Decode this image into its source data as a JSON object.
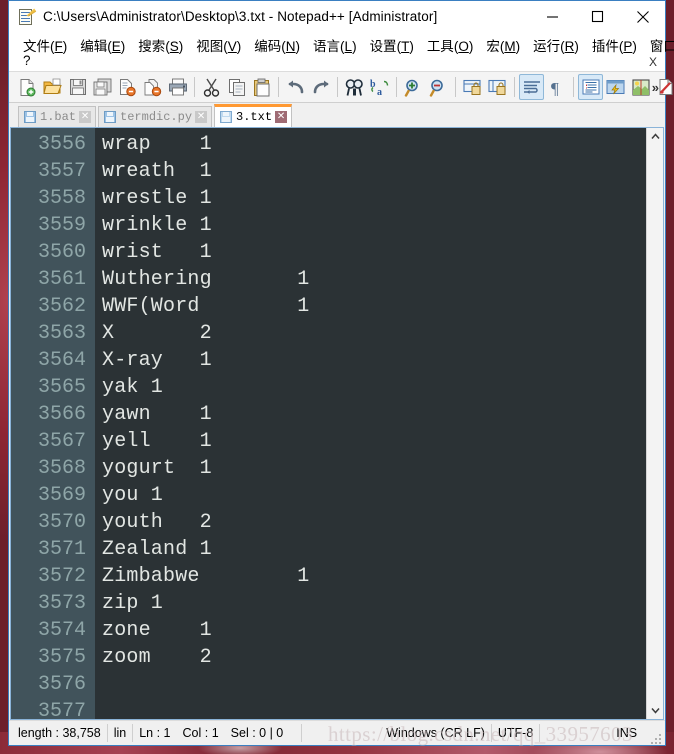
{
  "window": {
    "title": "C:\\Users\\Administrator\\Desktop\\3.txt - Notepad++ [Administrator]",
    "app_icon": "notepad-plus-plus-icon",
    "controls": {
      "minimize": "minimize-icon",
      "maximize": "maximize-icon",
      "close": "close-icon"
    },
    "menubar_close_label": "X"
  },
  "menubar": {
    "items": [
      {
        "text": "文件",
        "accel": "F"
      },
      {
        "text": "编辑",
        "accel": "E"
      },
      {
        "text": "搜索",
        "accel": "S"
      },
      {
        "text": "视图",
        "accel": "V"
      },
      {
        "text": "编码",
        "accel": "N"
      },
      {
        "text": "语言",
        "accel": "L"
      },
      {
        "text": "设置",
        "accel": "T"
      },
      {
        "text": "工具",
        "accel": "O"
      },
      {
        "text": "宏",
        "accel": "M"
      },
      {
        "text": "运行",
        "accel": "R"
      },
      {
        "text": "插件",
        "accel": "P"
      },
      {
        "text": "窗口",
        "accel": "W"
      }
    ],
    "help_label": "?",
    "row2_close_label": "X"
  },
  "toolbar": {
    "overflow_label": "»",
    "buttons": [
      {
        "name": "new-file-icon",
        "tooltip": "新建",
        "active": false
      },
      {
        "name": "open-file-icon",
        "tooltip": "打开",
        "active": false
      },
      {
        "name": "save-icon",
        "tooltip": "保存",
        "active": false
      },
      {
        "name": "save-all-icon",
        "tooltip": "保存所有",
        "active": false
      },
      {
        "name": "close-file-icon",
        "tooltip": "关闭",
        "active": false
      },
      {
        "name": "close-all-icon",
        "tooltip": "关闭所有",
        "active": false
      },
      {
        "name": "print-icon",
        "tooltip": "打印",
        "active": false
      },
      {
        "name": "separator",
        "tooltip": "",
        "active": false
      },
      {
        "name": "cut-icon",
        "tooltip": "剪切",
        "active": false
      },
      {
        "name": "copy-icon",
        "tooltip": "复制",
        "active": false
      },
      {
        "name": "paste-icon",
        "tooltip": "粘贴",
        "active": false
      },
      {
        "name": "separator",
        "tooltip": "",
        "active": false
      },
      {
        "name": "undo-icon",
        "tooltip": "撤销",
        "active": false
      },
      {
        "name": "redo-icon",
        "tooltip": "重做",
        "active": false
      },
      {
        "name": "separator",
        "tooltip": "",
        "active": false
      },
      {
        "name": "find-icon",
        "tooltip": "查找",
        "active": false
      },
      {
        "name": "replace-icon",
        "tooltip": "替换",
        "active": false
      },
      {
        "name": "separator",
        "tooltip": "",
        "active": false
      },
      {
        "name": "zoom-in-icon",
        "tooltip": "放大",
        "active": false
      },
      {
        "name": "zoom-out-icon",
        "tooltip": "缩小",
        "active": false
      },
      {
        "name": "separator",
        "tooltip": "",
        "active": false
      },
      {
        "name": "sync-vertical-scroll-icon",
        "tooltip": "同步垂直滚动",
        "active": false
      },
      {
        "name": "sync-horizontal-scroll-icon",
        "tooltip": "同步水平滚动",
        "active": false
      },
      {
        "name": "separator",
        "tooltip": "",
        "active": false
      },
      {
        "name": "word-wrap-icon",
        "tooltip": "自动换行",
        "active": true
      },
      {
        "name": "show-all-chars-icon",
        "tooltip": "显示所有字符",
        "active": false
      },
      {
        "name": "separator",
        "tooltip": "",
        "active": false
      },
      {
        "name": "indent-guide-icon",
        "tooltip": "显示缩进参考线",
        "active": true
      },
      {
        "name": "user-defined-dialog-icon",
        "tooltip": "用户自定义语言",
        "active": false
      },
      {
        "name": "document-map-icon",
        "tooltip": "文档地图",
        "active": false
      },
      {
        "name": "function-list-icon",
        "tooltip": "函数列表",
        "active": false
      },
      {
        "name": "folder-workspace-icon",
        "tooltip": "文件夹作为工作区",
        "active": false
      }
    ]
  },
  "tabs": [
    {
      "label": "1.bat",
      "active": false,
      "close_label": "✕"
    },
    {
      "label": "termdic.py",
      "active": false,
      "close_label": "✕"
    },
    {
      "label": "3.txt",
      "active": true,
      "close_label": "✕"
    }
  ],
  "editor": {
    "scrollbar": {
      "up_arrow": "chevron-up-icon",
      "down_arrow": "chevron-down-icon"
    },
    "lines": [
      {
        "number": "3556",
        "text": "wrap    1"
      },
      {
        "number": "3557",
        "text": "wreath  1"
      },
      {
        "number": "3558",
        "text": "wrestle 1"
      },
      {
        "number": "3559",
        "text": "wrinkle 1"
      },
      {
        "number": "3560",
        "text": "wrist   1"
      },
      {
        "number": "3561",
        "text": "Wuthering       1"
      },
      {
        "number": "3562",
        "text": "WWF(Word        1"
      },
      {
        "number": "3563",
        "text": "X       2"
      },
      {
        "number": "3564",
        "text": "X-ray   1"
      },
      {
        "number": "3565",
        "text": "yak 1"
      },
      {
        "number": "3566",
        "text": "yawn    1"
      },
      {
        "number": "3567",
        "text": "yell    1"
      },
      {
        "number": "3568",
        "text": "yogurt  1"
      },
      {
        "number": "3569",
        "text": "you 1"
      },
      {
        "number": "3570",
        "text": "youth   2"
      },
      {
        "number": "3571",
        "text": "Zealand 1"
      },
      {
        "number": "3572",
        "text": "Zimbabwe        1"
      },
      {
        "number": "3573",
        "text": "zip 1"
      },
      {
        "number": "3574",
        "text": "zone    1"
      },
      {
        "number": "3575",
        "text": "zoom    2"
      },
      {
        "number": "3576",
        "text": ""
      },
      {
        "number": "3577",
        "text": ""
      }
    ]
  },
  "statusbar": {
    "length": "length : 38,758",
    "lines_truncated": "lin",
    "ln": "Ln : 1",
    "col": "Col : 1",
    "sel": "Sel : 0 | 0",
    "eol": "Windows (CR LF)",
    "encoding": "UTF-8",
    "insert_mode": "INS"
  },
  "watermark": "https://blog.csdn.net/qq_33957603",
  "colors": {
    "editor_background": "#2b3235",
    "gutter_background": "#41535b",
    "editor_text": "#e2e6e3",
    "line_number_text": "#8fa6a8",
    "active_tab_accent": "#ff9933",
    "window_border": "#3a7fc1",
    "toolbar_active": "#d8e9f7"
  }
}
